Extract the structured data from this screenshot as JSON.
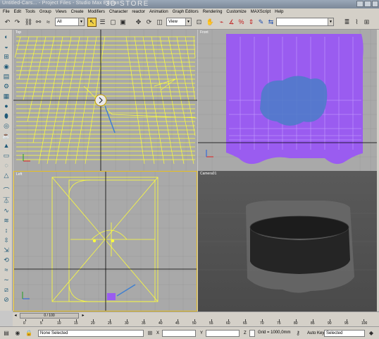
{
  "window": {
    "title": "Untitled-Cars... - Project Files - Studio Max Edition",
    "watermark": "3D STORE"
  },
  "menu": [
    "File",
    "Edit",
    "Tools",
    "Group",
    "Views",
    "Create",
    "Modifiers",
    "Character",
    "reactor",
    "Animation",
    "Graph Editors",
    "Rendering",
    "Customize",
    "MAXScript",
    "Help"
  ],
  "toolbar": {
    "selection_filter": "All",
    "reference_coord": "View",
    "named_selection": ""
  },
  "viewports": {
    "top_left": "Top",
    "top_right": "Front",
    "bottom_left": "Left",
    "bottom_right": "Camera01"
  },
  "timeline": {
    "frame_counter": "0 / 100",
    "ticks": [
      "0",
      "5",
      "10",
      "15",
      "20",
      "25",
      "30",
      "35",
      "40",
      "45",
      "50",
      "55",
      "60",
      "65",
      "70",
      "75",
      "80",
      "85",
      "90",
      "95",
      "100"
    ]
  },
  "status": {
    "selection": "None Selected",
    "x_label": "X",
    "y_label": "Y",
    "z_label": "Z",
    "grid": "Grid = 1000,0mm",
    "auto_key": "Auto Key",
    "key_filter": "Selected"
  },
  "colors": {
    "viewport_bg": "#a9a9a9",
    "grid_yellow": "#ffff3a",
    "purple_mesh": "#9a5cf0",
    "active_border": "#e8c020"
  }
}
